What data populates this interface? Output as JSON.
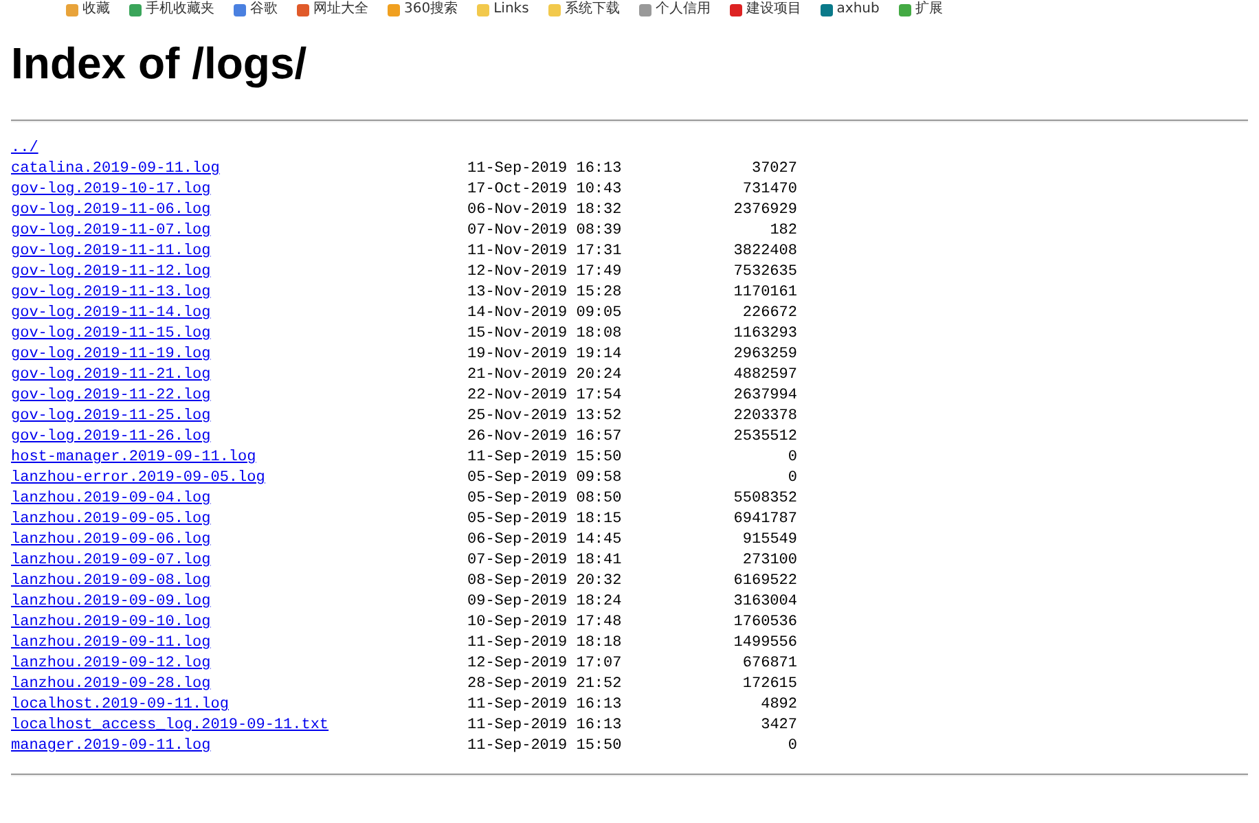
{
  "bookmarks_bar": {
    "items": [
      "收藏",
      "手机收藏夹",
      "谷歌",
      "网址大全",
      "360搜索",
      "Links",
      "系统下载",
      "个人信用",
      "建设项目",
      "axhub",
      "扩展"
    ]
  },
  "title": "Index of /logs/",
  "parent_link": "../",
  "entries": [
    {
      "name": "catalina.2019-09-11.log",
      "modified": "11-Sep-2019 16:13",
      "size": "37027"
    },
    {
      "name": "gov-log.2019-10-17.log",
      "modified": "17-Oct-2019 10:43",
      "size": "731470"
    },
    {
      "name": "gov-log.2019-11-06.log",
      "modified": "06-Nov-2019 18:32",
      "size": "2376929"
    },
    {
      "name": "gov-log.2019-11-07.log",
      "modified": "07-Nov-2019 08:39",
      "size": "182"
    },
    {
      "name": "gov-log.2019-11-11.log",
      "modified": "11-Nov-2019 17:31",
      "size": "3822408"
    },
    {
      "name": "gov-log.2019-11-12.log",
      "modified": "12-Nov-2019 17:49",
      "size": "7532635"
    },
    {
      "name": "gov-log.2019-11-13.log",
      "modified": "13-Nov-2019 15:28",
      "size": "1170161"
    },
    {
      "name": "gov-log.2019-11-14.log",
      "modified": "14-Nov-2019 09:05",
      "size": "226672"
    },
    {
      "name": "gov-log.2019-11-15.log",
      "modified": "15-Nov-2019 18:08",
      "size": "1163293"
    },
    {
      "name": "gov-log.2019-11-19.log",
      "modified": "19-Nov-2019 19:14",
      "size": "2963259"
    },
    {
      "name": "gov-log.2019-11-21.log",
      "modified": "21-Nov-2019 20:24",
      "size": "4882597"
    },
    {
      "name": "gov-log.2019-11-22.log",
      "modified": "22-Nov-2019 17:54",
      "size": "2637994"
    },
    {
      "name": "gov-log.2019-11-25.log",
      "modified": "25-Nov-2019 13:52",
      "size": "2203378"
    },
    {
      "name": "gov-log.2019-11-26.log",
      "modified": "26-Nov-2019 16:57",
      "size": "2535512"
    },
    {
      "name": "host-manager.2019-09-11.log",
      "modified": "11-Sep-2019 15:50",
      "size": "0"
    },
    {
      "name": "lanzhou-error.2019-09-05.log",
      "modified": "05-Sep-2019 09:58",
      "size": "0"
    },
    {
      "name": "lanzhou.2019-09-04.log",
      "modified": "05-Sep-2019 08:50",
      "size": "5508352"
    },
    {
      "name": "lanzhou.2019-09-05.log",
      "modified": "05-Sep-2019 18:15",
      "size": "6941787"
    },
    {
      "name": "lanzhou.2019-09-06.log",
      "modified": "06-Sep-2019 14:45",
      "size": "915549"
    },
    {
      "name": "lanzhou.2019-09-07.log",
      "modified": "07-Sep-2019 18:41",
      "size": "273100"
    },
    {
      "name": "lanzhou.2019-09-08.log",
      "modified": "08-Sep-2019 20:32",
      "size": "6169522"
    },
    {
      "name": "lanzhou.2019-09-09.log",
      "modified": "09-Sep-2019 18:24",
      "size": "3163004"
    },
    {
      "name": "lanzhou.2019-09-10.log",
      "modified": "10-Sep-2019 17:48",
      "size": "1760536"
    },
    {
      "name": "lanzhou.2019-09-11.log",
      "modified": "11-Sep-2019 18:18",
      "size": "1499556"
    },
    {
      "name": "lanzhou.2019-09-12.log",
      "modified": "12-Sep-2019 17:07",
      "size": "676871"
    },
    {
      "name": "lanzhou.2019-09-28.log",
      "modified": "28-Sep-2019 21:52",
      "size": "172615"
    },
    {
      "name": "localhost.2019-09-11.log",
      "modified": "11-Sep-2019 16:13",
      "size": "4892"
    },
    {
      "name": "localhost_access_log.2019-09-11.txt",
      "modified": "11-Sep-2019 16:13",
      "size": "3427"
    },
    {
      "name": "manager.2019-09-11.log",
      "modified": "11-Sep-2019 15:50",
      "size": "0"
    }
  ]
}
